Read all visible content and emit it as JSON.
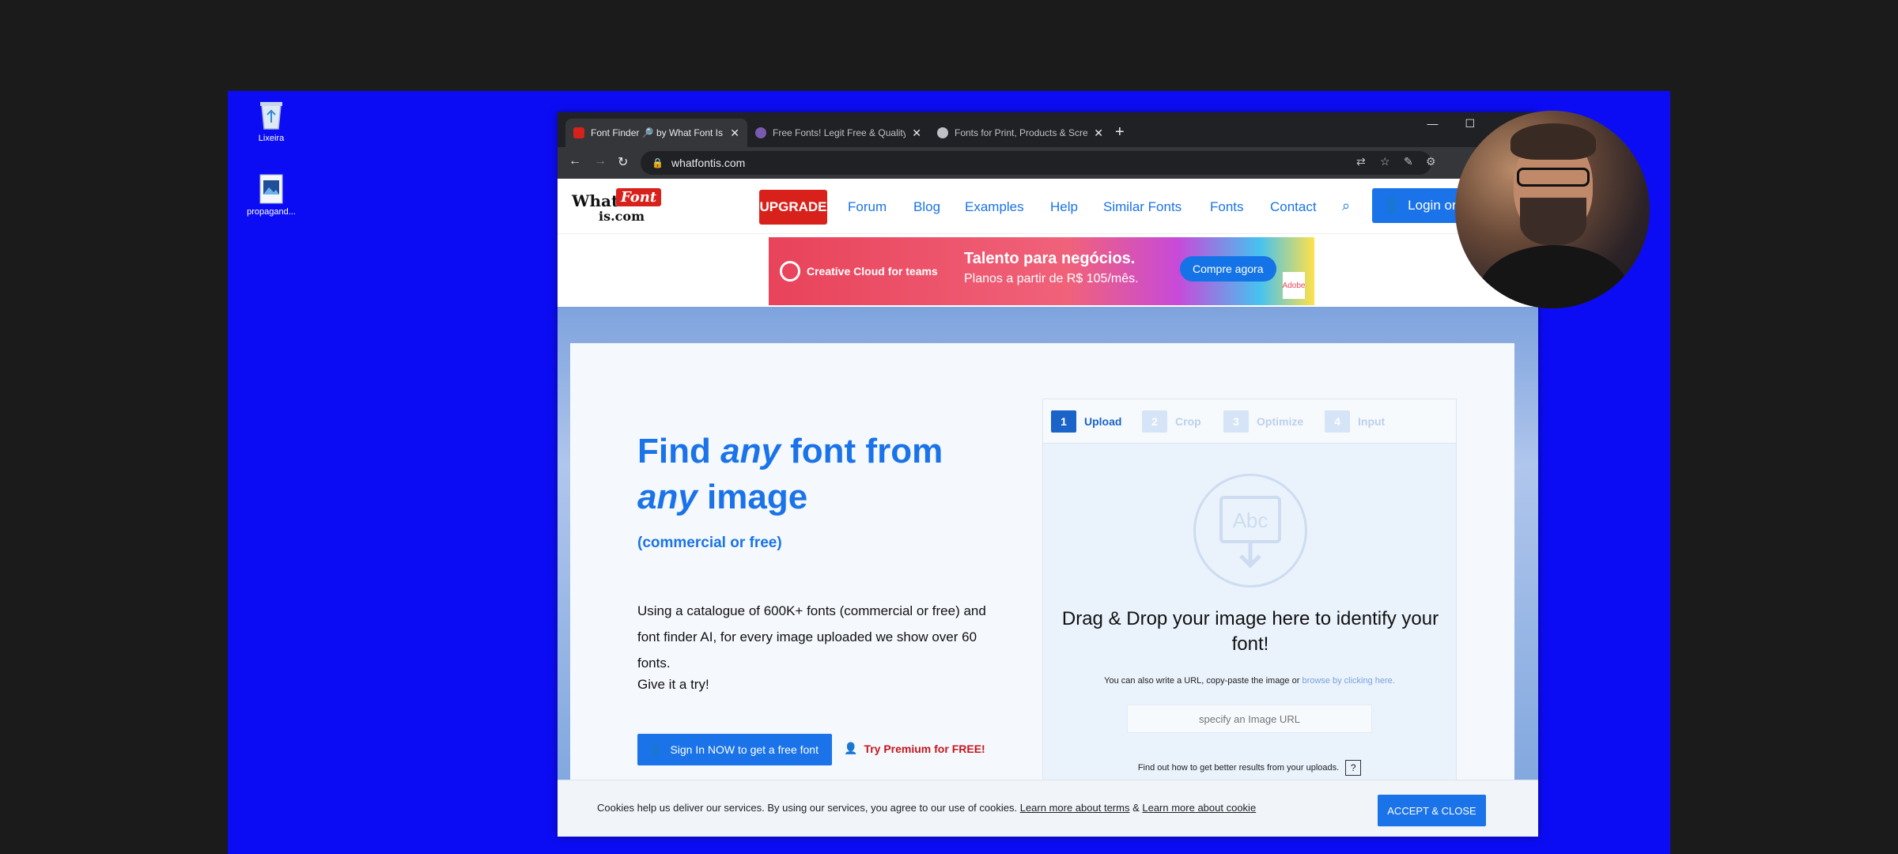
{
  "desktop": {
    "icons": [
      {
        "label": "Lixeira",
        "icon": "recycle-bin-icon"
      },
      {
        "label": "propagand...",
        "icon": "image-file-icon"
      }
    ]
  },
  "browser": {
    "tabs": [
      {
        "title": "Font Finder 🔎 by What Font Is",
        "active": true
      },
      {
        "title": "Free Fonts! Legit Free & Quality |",
        "active": false
      },
      {
        "title": "Fonts for Print, Products & Scre",
        "active": false
      }
    ],
    "new_tab": "+",
    "window_controls": [
      "—",
      "☐"
    ],
    "url": "whatfontis.com"
  },
  "site": {
    "logo": {
      "word1": "What",
      "word2": "Font",
      "domain": "is.com"
    },
    "upgrade_label": "UPGRADE",
    "nav": [
      "Forum",
      "Blog",
      "Examples",
      "Help",
      "Similar Fonts",
      "Fonts",
      "Contact"
    ],
    "login_label": "Login or",
    "ad": {
      "brand": "Creative Cloud for teams",
      "headline": "Talento para negócios.",
      "subline": "Planos a partir de R$ 105/mês.",
      "cta": "Compre agora",
      "adobe": "Adobe"
    },
    "hero": {
      "title_part1": "Find ",
      "title_any1": "any",
      "title_part2": " font from ",
      "title_any2": "any",
      "title_part3": " image",
      "subtitle": "(commercial or free)",
      "description": "Using a catalogue of 600K+ fonts (commercial or free) and font finder AI, for every image uploaded we show over 60 fonts.",
      "try_text": "Give it a try!",
      "signin_label": "Sign In NOW to get a free font",
      "premium_label": "Try Premium for FREE!"
    },
    "upload": {
      "steps": [
        {
          "num": "1",
          "label": "Upload"
        },
        {
          "num": "2",
          "label": "Crop"
        },
        {
          "num": "3",
          "label": "Optimize"
        },
        {
          "num": "4",
          "label": "Input"
        }
      ],
      "icon_text": "Abc",
      "drag_text": "Drag & Drop your image here to identify your font!",
      "also_text": "You can also write a URL, copy-paste the image or ",
      "browse_link": "browse by clicking here.",
      "url_placeholder": "specify an Image URL",
      "findout_text": "Find out how to get better results from your uploads.",
      "help_q": "?"
    },
    "cookie": {
      "text": "Cookies help us deliver our services. By using our services, you agree to our use of cookies. ",
      "link_terms": "Learn more about terms",
      "amp": " & ",
      "link_cookie": "Learn more about cookie",
      "accept_label": "ACCEPT & CLOSE"
    }
  },
  "colors": {
    "desktop_bg": "#0c0cf4",
    "brand_blue": "#1a73e8",
    "brand_red": "#d9211b"
  }
}
